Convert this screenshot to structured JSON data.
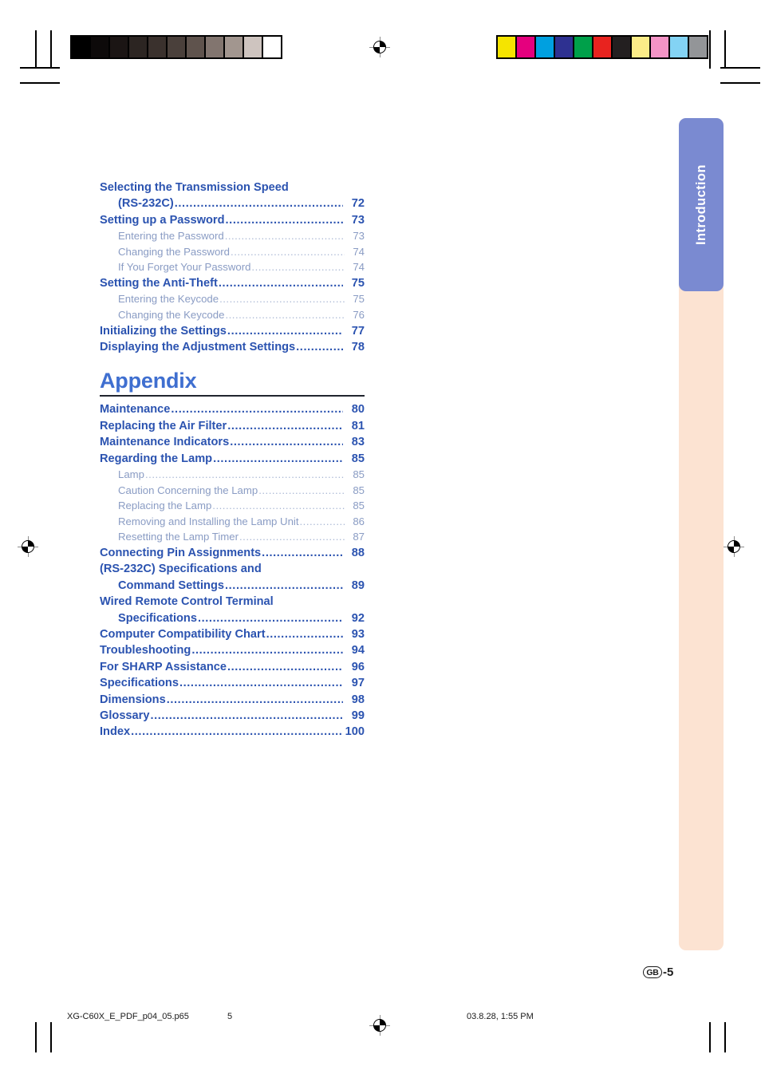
{
  "side_tab": {
    "label": "Introduction",
    "tab_color": "#7a8ad1",
    "column_color": "#fce3d2"
  },
  "colors": {
    "level1_text": "#2b53b0",
    "level2_text": "#8a9cc4",
    "appendix_heading": "#3f6fd0",
    "rule": "#20252e"
  },
  "toc": {
    "continued_section": [
      {
        "level": 1,
        "title": "Selecting the Transmission Speed",
        "page": "",
        "wrapped": true
      },
      {
        "level": 1,
        "title": "(RS-232C)",
        "page": "72",
        "continuation": true
      },
      {
        "level": 1,
        "title": "Setting up a Password",
        "page": "73"
      },
      {
        "level": 2,
        "title": "Entering the Password",
        "page": "73"
      },
      {
        "level": 2,
        "title": "Changing the Password",
        "page": "74"
      },
      {
        "level": 2,
        "title": "If You Forget Your Password",
        "page": "74"
      },
      {
        "level": 1,
        "title": "Setting the Anti-Theft",
        "page": "75"
      },
      {
        "level": 2,
        "title": "Entering the Keycode",
        "page": "75"
      },
      {
        "level": 2,
        "title": "Changing the Keycode",
        "page": "76"
      },
      {
        "level": 1,
        "title": "Initializing the Settings",
        "page": "77"
      },
      {
        "level": 1,
        "title": "Displaying the Adjustment Settings",
        "page": "78"
      }
    ],
    "appendix_heading": "Appendix",
    "appendix_section": [
      {
        "level": 1,
        "title": "Maintenance",
        "page": "80"
      },
      {
        "level": 1,
        "title": "Replacing the Air Filter",
        "page": "81"
      },
      {
        "level": 1,
        "title": "Maintenance Indicators",
        "page": "83"
      },
      {
        "level": 1,
        "title": "Regarding the Lamp",
        "page": "85"
      },
      {
        "level": 2,
        "title": "Lamp",
        "page": "85"
      },
      {
        "level": 2,
        "title": "Caution Concerning the Lamp",
        "page": "85"
      },
      {
        "level": 2,
        "title": "Replacing the Lamp",
        "page": "85"
      },
      {
        "level": 2,
        "title": "Removing and Installing the Lamp Unit",
        "page": "86"
      },
      {
        "level": 2,
        "title": "Resetting the Lamp Timer",
        "page": "87"
      },
      {
        "level": 1,
        "title": "Connecting Pin Assignments",
        "page": "88"
      },
      {
        "level": 1,
        "title": "(RS-232C) Specifications and",
        "page": "",
        "wrapped": true
      },
      {
        "level": 1,
        "title": "Command Settings",
        "page": "89",
        "continuation": true
      },
      {
        "level": 1,
        "title": "Wired Remote Control Terminal",
        "page": "",
        "wrapped": true
      },
      {
        "level": 1,
        "title": "Specifications",
        "page": "92",
        "continuation": true
      },
      {
        "level": 1,
        "title": "Computer Compatibility Chart",
        "page": "93"
      },
      {
        "level": 1,
        "title": "Troubleshooting",
        "page": "94"
      },
      {
        "level": 1,
        "title": "For SHARP Assistance",
        "page": "96"
      },
      {
        "level": 1,
        "title": "Specifications",
        "page": "97"
      },
      {
        "level": 1,
        "title": "Dimensions",
        "page": "98"
      },
      {
        "level": 1,
        "title": "Glossary",
        "page": "99"
      },
      {
        "level": 1,
        "title": "Index",
        "page": "100"
      }
    ]
  },
  "footer": {
    "region_badge": "GB",
    "page_suffix": "-5",
    "print_file": "XG-C60X_E_PDF_p04_05.p65",
    "print_page": "5",
    "print_date": "03.8.28, 1:55 PM"
  },
  "calibration": {
    "grayscale_patches": [
      "#000000",
      "#0d0a0a",
      "#1b1514",
      "#2c2522",
      "#3a312d",
      "#4a403b",
      "#5f534d",
      "#82756f",
      "#a2968f",
      "#cec4bf",
      "#ffffff"
    ],
    "color_patches": [
      "#f5e400",
      "#e5007e",
      "#00a0e0",
      "#2e3191",
      "#00a04a",
      "#e8231f",
      "#231f20",
      "#fbec88",
      "#f494c6",
      "#83d3f4",
      "#939598"
    ]
  }
}
